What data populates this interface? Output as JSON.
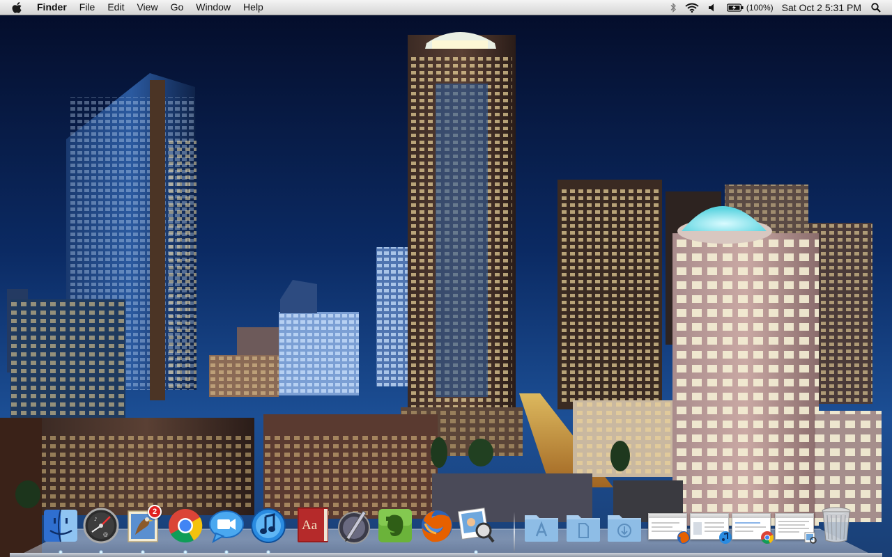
{
  "menubar": {
    "apple": "apple-logo-icon",
    "app_name": "Finder",
    "items": [
      "File",
      "Edit",
      "View",
      "Go",
      "Window",
      "Help"
    ],
    "status": {
      "bluetooth": "bluetooth-icon",
      "wifi": "wifi-icon",
      "volume": "volume-icon",
      "battery_icon": "battery-icon",
      "battery_text": "(100%)",
      "clock": "Sat Oct 2  5:31 PM",
      "spotlight": "spotlight-search-icon"
    }
  },
  "desktop": {
    "wallpaper": "night city skyline"
  },
  "dock": {
    "apps": [
      {
        "name": "Finder",
        "icon": "finder-icon",
        "running": true
      },
      {
        "name": "Dashboard",
        "icon": "dashboard-icon",
        "running": true
      },
      {
        "name": "Mail",
        "icon": "mail-icon",
        "running": true,
        "badge": "2"
      },
      {
        "name": "Google Chrome",
        "icon": "chrome-icon",
        "running": true
      },
      {
        "name": "iChat",
        "icon": "ichat-icon",
        "running": true
      },
      {
        "name": "iTunes",
        "icon": "itunes-icon",
        "running": true
      },
      {
        "name": "Dictionary",
        "icon": "dictionary-icon",
        "running": false
      },
      {
        "name": "Script Editor",
        "icon": "script-editor-icon",
        "running": false
      },
      {
        "name": "Evernote",
        "icon": "evernote-icon",
        "running": false
      },
      {
        "name": "Firefox",
        "icon": "firefox-icon",
        "running": false
      },
      {
        "name": "Preview",
        "icon": "preview-icon",
        "running": true
      }
    ],
    "stacks": [
      {
        "name": "Applications",
        "icon": "applications-folder-icon"
      },
      {
        "name": "Documents",
        "icon": "documents-folder-icon"
      },
      {
        "name": "Downloads",
        "icon": "downloads-folder-icon"
      }
    ],
    "minimized": [
      {
        "name": "Minimized Firefox window",
        "icon": "firefox-mini-icon"
      },
      {
        "name": "Minimized iTunes window",
        "icon": "itunes-mini-icon"
      },
      {
        "name": "Minimized Chrome window",
        "icon": "chrome-mini-icon"
      },
      {
        "name": "Minimized Preview window",
        "icon": "preview-mini-icon"
      }
    ],
    "trash": {
      "name": "Trash",
      "icon": "trash-icon"
    },
    "badge_color": "#e02020"
  },
  "colors": {
    "sky_top": "#040e2c",
    "sky_bottom": "#1b4f96",
    "menubar": "#e8e8e8"
  }
}
